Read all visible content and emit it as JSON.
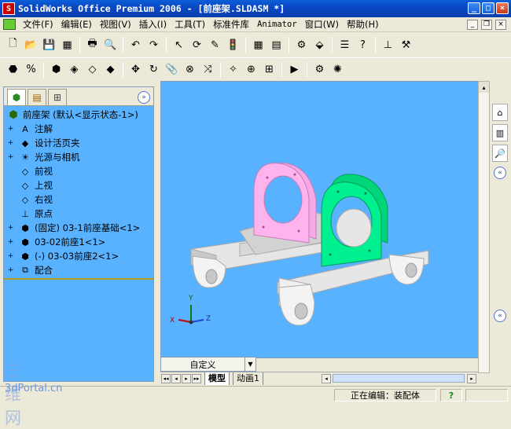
{
  "window": {
    "title": "SolidWorks Office Premium 2006 - [前座架.SLDASM *]",
    "minimize": "_",
    "maximize": "□",
    "close": "×"
  },
  "menu": {
    "items": [
      "文件(F)",
      "编辑(E)",
      "视图(V)",
      "插入(I)",
      "工具(T)",
      "标准件库",
      "Animator",
      "窗口(W)",
      "帮助(H)"
    ],
    "mdi_min": "_",
    "mdi_restore": "❐",
    "mdi_close": "×"
  },
  "toolbar1": [
    {
      "icon": "new-file-icon",
      "glyph": "🗋"
    },
    {
      "icon": "open-folder-icon",
      "glyph": "📂"
    },
    {
      "icon": "save-icon",
      "glyph": "💾"
    },
    {
      "icon": "make-drawing-icon",
      "glyph": "▦"
    },
    {
      "icon": "print-icon",
      "glyph": "🖶"
    },
    {
      "icon": "print-preview-icon",
      "glyph": "🔍"
    },
    {
      "icon": "undo-icon",
      "glyph": "↶"
    },
    {
      "icon": "redo-icon",
      "glyph": "↷"
    },
    {
      "icon": "select-icon",
      "glyph": "↖"
    },
    {
      "icon": "smart-dimension-icon",
      "glyph": "⟳"
    },
    {
      "icon": "sketch-icon",
      "glyph": "✎"
    },
    {
      "icon": "traffic-light-icon",
      "glyph": "🚦"
    },
    {
      "icon": "grid-icon",
      "glyph": "▦"
    },
    {
      "icon": "brick-wall-icon",
      "glyph": "▤"
    },
    {
      "icon": "options-icon",
      "glyph": "⚙"
    },
    {
      "icon": "component-icon",
      "glyph": "⬙"
    },
    {
      "icon": "property-icon",
      "glyph": "☰"
    },
    {
      "icon": "help-icon",
      "glyph": "?"
    },
    {
      "icon": "sheet-icon",
      "glyph": "⊥"
    },
    {
      "icon": "toolbox-icon",
      "glyph": "⚒"
    }
  ],
  "toolbar2": [
    {
      "icon": "assembly-icon",
      "glyph": "⬣"
    },
    {
      "icon": "measure-icon",
      "glyph": "%"
    },
    {
      "icon": "insert-component-icon",
      "glyph": "⬢"
    },
    {
      "icon": "hide-show-icon",
      "glyph": "◈"
    },
    {
      "icon": "change-transparency-icon",
      "glyph": "◇"
    },
    {
      "icon": "edit-component-icon",
      "glyph": "◆"
    },
    {
      "icon": "move-component-icon",
      "glyph": "✥"
    },
    {
      "icon": "rotate-component-icon",
      "glyph": "↻"
    },
    {
      "icon": "mate-icon",
      "glyph": "📎"
    },
    {
      "icon": "exploded-view-icon",
      "glyph": "⊗"
    },
    {
      "icon": "explode-line-icon",
      "glyph": "⤨"
    },
    {
      "icon": "interference-icon",
      "glyph": "✧"
    },
    {
      "icon": "feature-icon",
      "glyph": "⊕"
    },
    {
      "icon": "smart-fastener-icon",
      "glyph": "⊞"
    },
    {
      "icon": "simulation-icon",
      "glyph": "▶"
    },
    {
      "icon": "assembly-features-icon",
      "glyph": "⚙"
    },
    {
      "icon": "smart-mate-icon",
      "glyph": "✺"
    }
  ],
  "featuremanager": {
    "tabs": [
      "feature-tree-tab",
      "property-manager-tab",
      "configuration-manager-tab"
    ],
    "collapse": "»",
    "root": "前座架  (默认<显示状态-1>)",
    "items": [
      {
        "label": "注解",
        "icon": "annotations-icon",
        "glyph": "A",
        "expand": true
      },
      {
        "label": "设计活页夹",
        "icon": "design-binder-icon",
        "glyph": "◆",
        "expand": true
      },
      {
        "label": "光源与相机",
        "icon": "lights-cameras-icon",
        "glyph": "☀",
        "expand": true
      },
      {
        "label": "前视",
        "icon": "plane-icon",
        "glyph": "◇",
        "expand": false
      },
      {
        "label": "上视",
        "icon": "plane-icon",
        "glyph": "◇",
        "expand": false
      },
      {
        "label": "右视",
        "icon": "plane-icon",
        "glyph": "◇",
        "expand": false
      },
      {
        "label": "原点",
        "icon": "origin-icon",
        "glyph": "⊥",
        "expand": false
      },
      {
        "label": "(固定) 03-1前座基础<1>",
        "icon": "part-icon",
        "glyph": "⬢",
        "expand": true
      },
      {
        "label": "03-02前座1<1>",
        "icon": "part-icon",
        "glyph": "⬢",
        "expand": true
      },
      {
        "label": "(-) 03-03前座2<1>",
        "icon": "part-icon",
        "glyph": "⬢",
        "expand": true
      },
      {
        "label": "配合",
        "icon": "mates-icon",
        "glyph": "⧉",
        "expand": true
      }
    ]
  },
  "viewport": {
    "dock_label": "自定义",
    "dock_arrow": "▼",
    "colors": {
      "background": "#59b2ff",
      "part_pink": "#ff9fe6",
      "part_green": "#00ee88",
      "base_gray": "#dcdcdc"
    },
    "triad": {
      "x": "X",
      "y": "Y",
      "z": "Z"
    }
  },
  "sheet_tabs": {
    "nav": [
      "◂◂",
      "◂",
      "▸",
      "▸▸"
    ],
    "tabs": [
      "模型",
      "动画1"
    ]
  },
  "taskpane": {
    "icons": [
      {
        "icon": "home-icon",
        "glyph": "⌂"
      },
      {
        "icon": "design-library-icon",
        "glyph": "▥"
      },
      {
        "icon": "file-explorer-icon",
        "glyph": "🔎"
      }
    ],
    "collapse": "«"
  },
  "statusbar": {
    "watermark_top": "三维网",
    "watermark": "3dPortal.cn",
    "status": "正在编辑：装配体",
    "help": "?"
  }
}
